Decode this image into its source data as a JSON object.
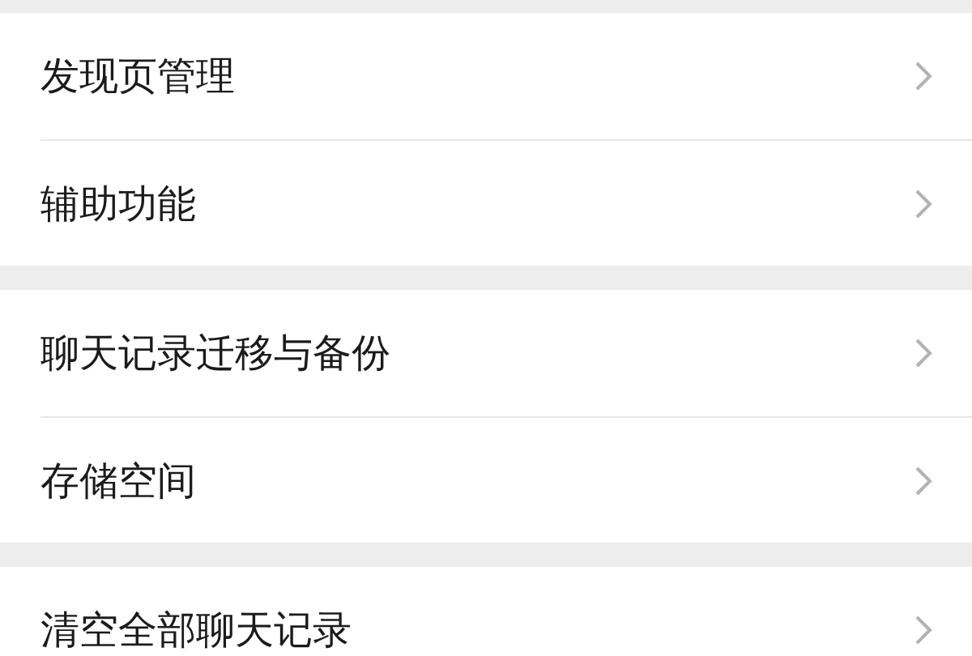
{
  "sections": [
    {
      "items": [
        {
          "label": "发现页管理"
        },
        {
          "label": "辅助功能"
        }
      ]
    },
    {
      "items": [
        {
          "label": "聊天记录迁移与备份"
        },
        {
          "label": "存储空间"
        }
      ]
    },
    {
      "items": [
        {
          "label": "清空全部聊天记录"
        }
      ]
    }
  ]
}
